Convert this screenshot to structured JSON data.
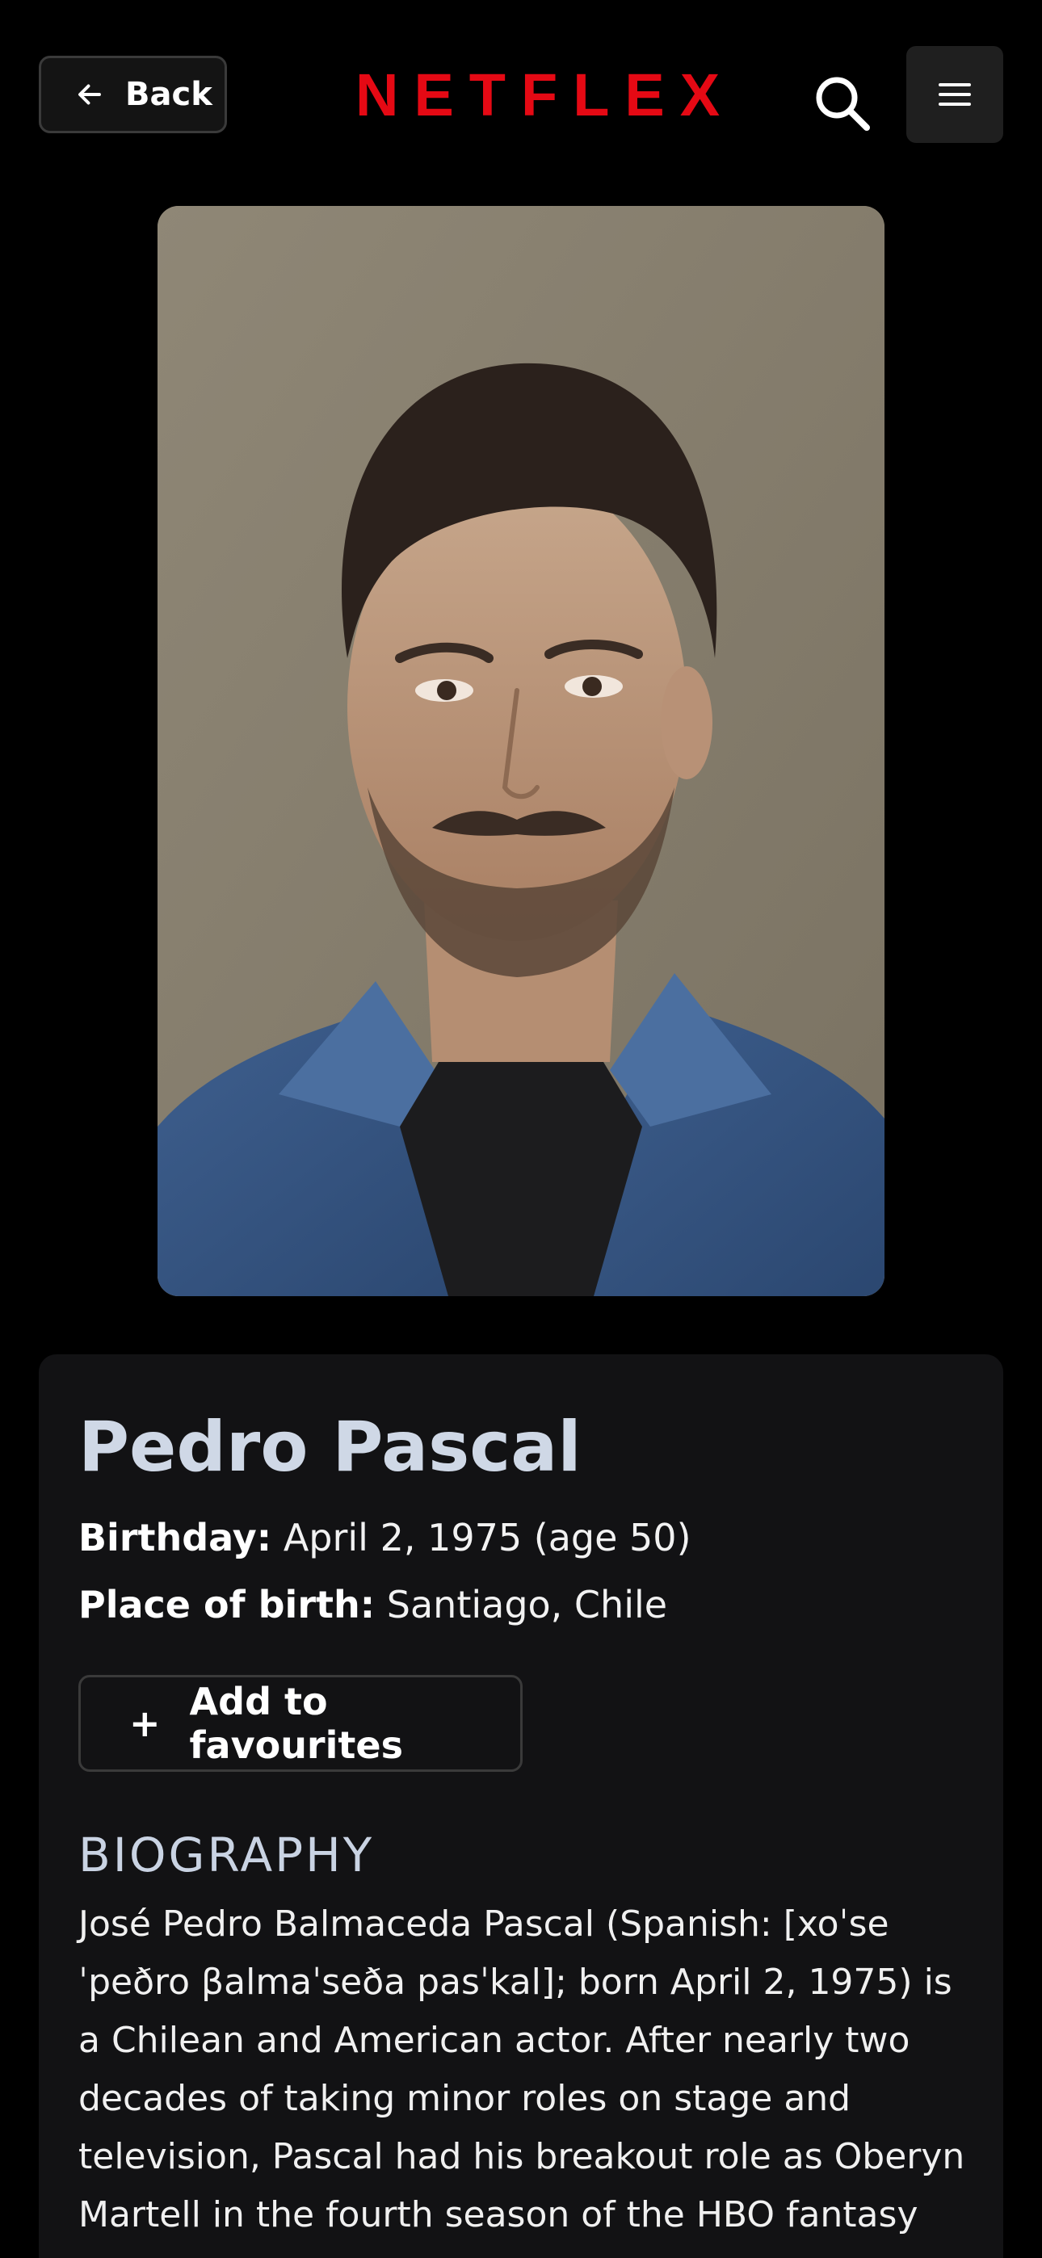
{
  "header": {
    "back_label": "Back",
    "logo_text": "NETFLEX",
    "logo_color": "#e50914",
    "search_icon": "search-icon",
    "menu_icon": "hamburger-menu-icon"
  },
  "person": {
    "photo_alt": "Pedro Pascal portrait",
    "name": "Pedro Pascal",
    "birthday_label": "Birthday:",
    "birthday_value": "April 2, 1975 (age 50)",
    "birthplace_label": "Place of birth:",
    "birthplace_value": "Santiago, Chile"
  },
  "actions": {
    "add_favourites_label": "Add to favourites",
    "add_icon": "+"
  },
  "biography": {
    "heading": "BIOGRAPHY",
    "text": "José Pedro Balmaceda Pascal (Spanish: [xoˈse ˈpeðro βalmaˈseða pasˈkal]; born April 2, 1975) is a Chilean and American actor. After nearly two decades of taking minor roles on stage and television, Pascal had his breakout role as Oberyn Martell in the fourth season of the HBO fantasy"
  },
  "colors": {
    "background": "#000000",
    "card": "#121214",
    "name": "#cfd8e6",
    "accent": "#e50914"
  }
}
